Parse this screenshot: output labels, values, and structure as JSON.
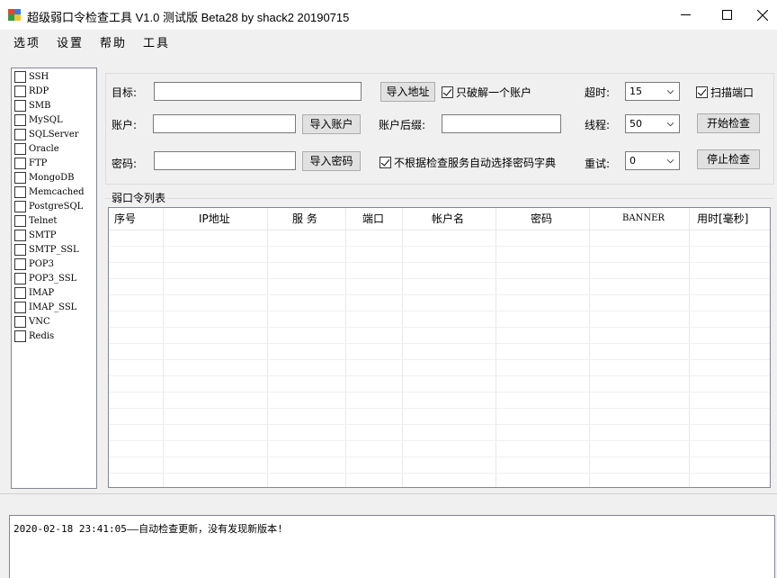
{
  "window": {
    "title": "超级弱口令检查工具 V1.0 测试版 Beta28 by shack2 20190715"
  },
  "menu": [
    "选项",
    "设置",
    "帮助",
    "工具"
  ],
  "services": [
    {
      "label": "SSH",
      "checked": false
    },
    {
      "label": "RDP",
      "checked": false
    },
    {
      "label": "SMB",
      "checked": false
    },
    {
      "label": "MySQL",
      "checked": false
    },
    {
      "label": "SQLServer",
      "checked": false
    },
    {
      "label": "Oracle",
      "checked": false
    },
    {
      "label": "FTP",
      "checked": false
    },
    {
      "label": "MongoDB",
      "checked": false
    },
    {
      "label": "Memcached",
      "checked": false
    },
    {
      "label": "PostgreSQL",
      "checked": false
    },
    {
      "label": "Telnet",
      "checked": false
    },
    {
      "label": "SMTP",
      "checked": false
    },
    {
      "label": "SMTP_SSL",
      "checked": false
    },
    {
      "label": "POP3",
      "checked": false
    },
    {
      "label": "POP3_SSL",
      "checked": false
    },
    {
      "label": "IMAP",
      "checked": false
    },
    {
      "label": "IMAP_SSL",
      "checked": false
    },
    {
      "label": "VNC",
      "checked": false
    },
    {
      "label": "Redis",
      "checked": false
    }
  ],
  "form": {
    "target_label": "目标:",
    "target_value": "",
    "import_target_button": "导入地址",
    "crack_one_label": "只破解一个账户",
    "crack_one_checked": true,
    "timeout_label": "超时:",
    "timeout_value": "15",
    "scan_port_label": "扫描端口",
    "scan_port_checked": true,
    "account_label": "账户:",
    "account_value": "",
    "import_account_button": "导入账户",
    "suffix_label": "账户后缀:",
    "suffix_value": "",
    "threads_label": "线程:",
    "threads_value": "50",
    "start_button": "开始检查",
    "password_label": "密码:",
    "password_value": "",
    "import_password_button": "导入密码",
    "auto_dict_label": "不根据检查服务自动选择密码字典",
    "auto_dict_checked": true,
    "retry_label": "重试:",
    "retry_value": "0",
    "stop_button": "停止检查"
  },
  "results": {
    "group_label": "弱口令列表",
    "columns": [
      "序号",
      "IP地址",
      "服 务",
      "端口",
      "帐户名",
      "密码",
      "BANNER",
      "用时[毫秒]"
    ],
    "rows": []
  },
  "log": {
    "text": "2020-02-18 23:41:05——自动检查更新，没有发现新版本!"
  }
}
